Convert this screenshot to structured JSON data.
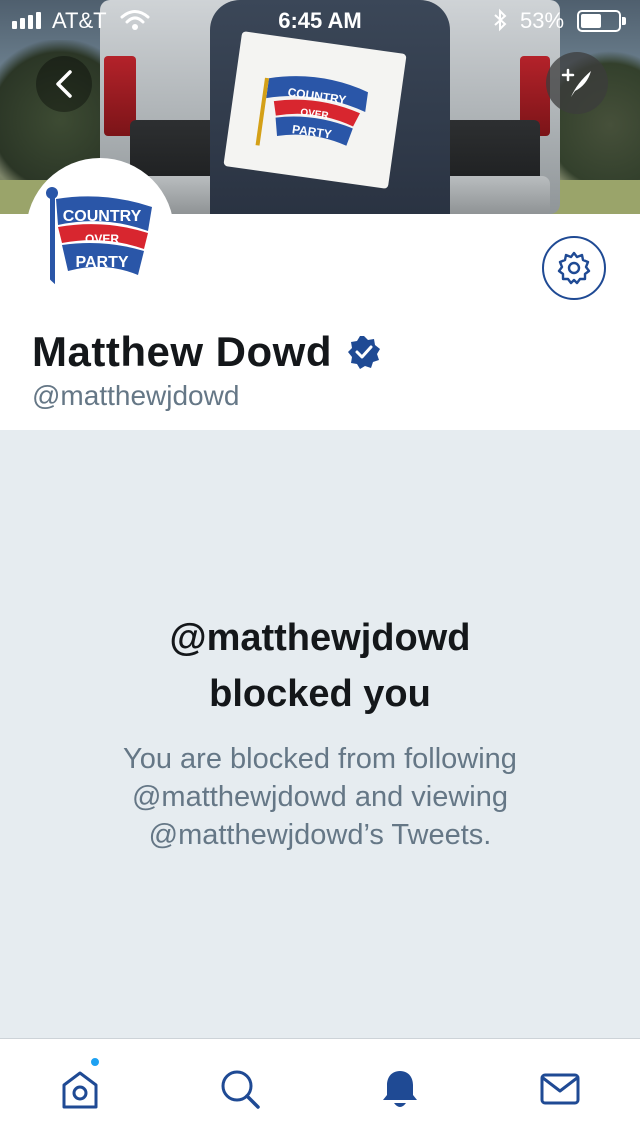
{
  "status_bar": {
    "carrier": "AT&T",
    "time": "6:45 AM",
    "battery_percent": "53%"
  },
  "banner": {
    "flag_text": [
      "COUNTRY",
      "OVER",
      "PARTY"
    ]
  },
  "profile": {
    "display_name": "Matthew Dowd",
    "handle": "@matthewjdowd",
    "verified": true
  },
  "blocked": {
    "title_line1": "@matthewjdowd",
    "title_line2": "blocked you",
    "description": "You are blocked from following @matthewjdowd and viewing @matthewjdowd’s Tweets."
  },
  "tab_bar": {
    "active_tab": "notifications",
    "home_has_new": true
  },
  "colors": {
    "accent": "#1f4a94",
    "verified": "#1f4a94",
    "panel_bg": "#e6ecf0",
    "notification_dot": "#1da1f2"
  },
  "icons": [
    "back-icon",
    "compose-icon",
    "gear-icon",
    "verified-icon",
    "home-icon",
    "search-icon",
    "bell-icon",
    "mail-icon"
  ]
}
